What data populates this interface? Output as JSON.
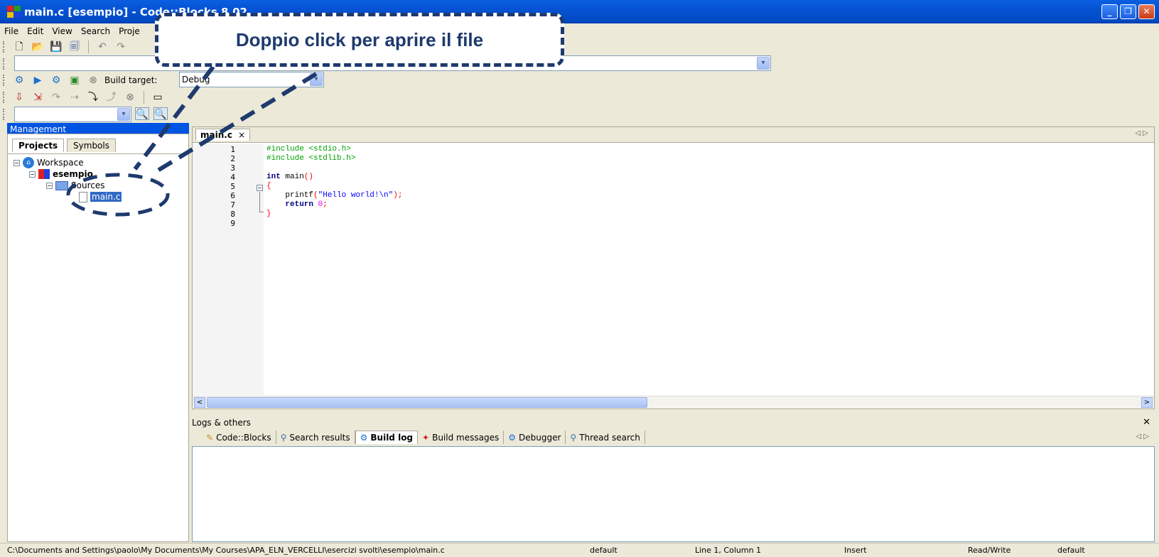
{
  "window": {
    "title": "main.c [esempio] - Code::Blocks 8.02",
    "min": "_",
    "max": "❐",
    "close": "✕"
  },
  "menu": [
    "File",
    "Edit",
    "View",
    "Search",
    "Proje"
  ],
  "build": {
    "label": "Build target:",
    "value": "Debug"
  },
  "management": {
    "title": "Management",
    "tabs": [
      "Projects",
      "Symbols"
    ],
    "tree": {
      "workspace": "Workspace",
      "project": "esempio",
      "folder": "Sources",
      "file": "main.c"
    }
  },
  "editor": {
    "tab": "main.c",
    "tab_close": "×",
    "line_numbers": [
      "1",
      "2",
      "3",
      "4",
      "5",
      "6",
      "7",
      "8",
      "9"
    ],
    "code": {
      "l1": "#include <stdio.h>",
      "l2": "#include <stdlib.h>",
      "l4_kw": "int",
      "l4_rest": " main",
      "l4_paren": "()",
      "l5": "{",
      "l6_fn": "    printf",
      "l6_open": "(",
      "l6_str": "\"Hello world!\\n\"",
      "l6_close": ");",
      "l7_kw": "    return",
      "l7_num": " 0",
      "l7_end": ";",
      "l8": "}"
    },
    "scroll_left": "<",
    "scroll_right": ">",
    "nav": "◁  ▷"
  },
  "logs": {
    "title": "Logs & others",
    "close": "✕",
    "tabs": [
      "Code::Blocks",
      "Search results",
      "Build log",
      "Build messages",
      "Debugger",
      "Thread search"
    ],
    "active_tab": "Build log",
    "nav": "◁  ▷"
  },
  "status": {
    "path": "C:\\Documents and Settings\\paolo\\My Documents\\My Courses\\APA_ELN_VERCELLI\\esercizi svolti\\esempio\\main.c",
    "encoding": "default",
    "position": "Line 1, Column 1",
    "mode": "Insert",
    "access": "Read/Write",
    "lang": "default"
  },
  "callout": {
    "text": "Doppio click per aprire il file"
  },
  "colors": {
    "accent": "#1e3a6e",
    "titlebar": "#0054e3",
    "chrome": "#ece9d8"
  }
}
